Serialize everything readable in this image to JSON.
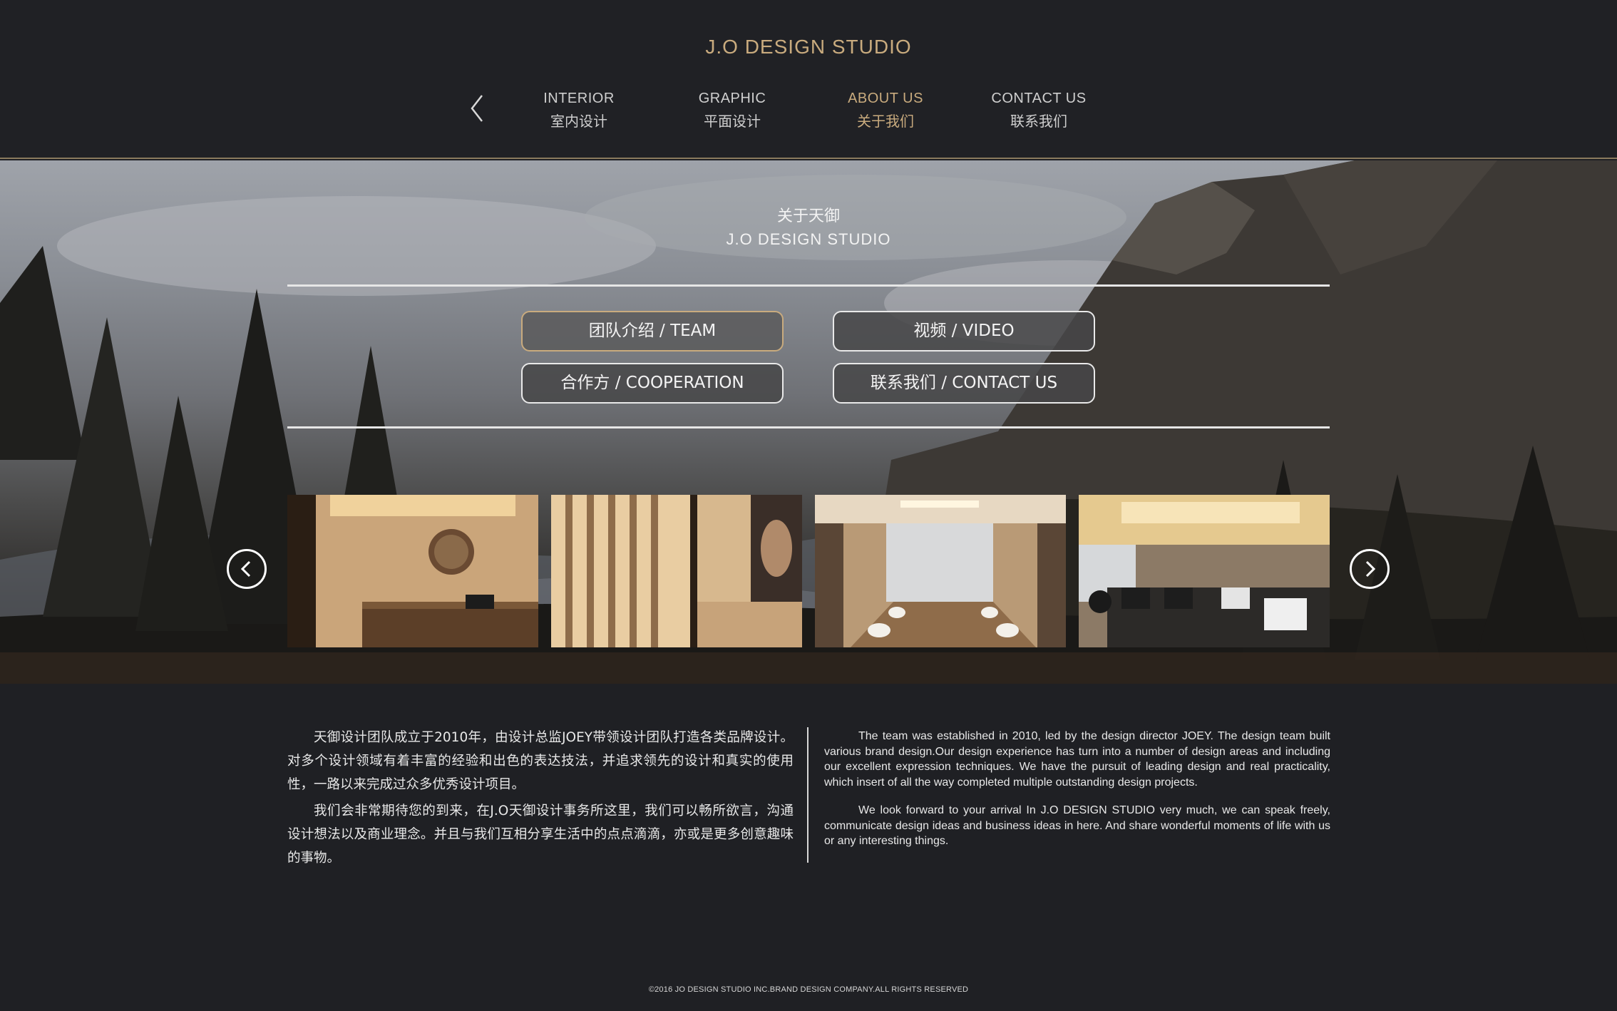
{
  "header": {
    "brand": "J.O DESIGN STUDIO",
    "nav": [
      {
        "en": "INTERIOR",
        "cn": "室内设计",
        "active": false
      },
      {
        "en": "GRAPHIC",
        "cn": "平面设计",
        "active": false
      },
      {
        "en": "ABOUT US",
        "cn": "关于我们",
        "active": true
      },
      {
        "en": "CONTACT US",
        "cn": "联系我们",
        "active": false
      }
    ]
  },
  "hero": {
    "title_cn": "关于天御",
    "title_en": "J.O DESIGN STUDIO",
    "buttons": [
      {
        "label": "团队介绍 / TEAM",
        "active": true
      },
      {
        "label": "视频 / VIDEO",
        "active": false
      },
      {
        "label": "合作方 / COOPERATION",
        "active": false
      },
      {
        "label": "联系我们 / CONTACT US",
        "active": false
      }
    ]
  },
  "about": {
    "cn": [
      "天御设计团队成立于2010年，由设计总监JOEY带领设计团队打造各类品牌设计。对多个设计领域有着丰富的经验和出色的表达技法，并追求领先的设计和真实的使用性，一路以来完成过众多优秀设计项目。",
      "我们会非常期待您的到来，在J.O天御设计事务所这里，我们可以畅所欲言，沟通设计想法以及商业理念。并且与我们互相分享生活中的点点滴滴，亦或是更多创意趣味的事物。"
    ],
    "en": [
      "The team was established in 2010, led by the design director JOEY. The design team built various brand design.Our design experience has turn into a number of design areas and including our excellent expression techniques. We have the pursuit of leading design and real practicality, which insert of all the way completed multiple outstanding design projects.",
      "We look forward to your arrival In J.O DESIGN STUDIO very much, we can speak freely, communicate design ideas and business ideas in here. And share wonderful moments of life with us or any interesting things."
    ]
  },
  "footer": "©2016 JO DESIGN STUDIO INC.BRAND DESIGN COMPANY.ALL RIGHTS RESERVED",
  "colors": {
    "accent": "#c9ab7e",
    "background": "#1f2024"
  }
}
